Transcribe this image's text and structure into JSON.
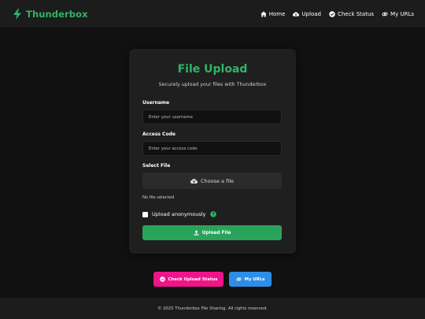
{
  "brand": {
    "name": "Thunderbox",
    "icon": "bolt-icon",
    "color": "#2fb566"
  },
  "nav": {
    "items": [
      {
        "label": "Home",
        "icon": "home-icon"
      },
      {
        "label": "Upload",
        "icon": "cloud-upload-icon"
      },
      {
        "label": "Check Status",
        "icon": "check-circle-icon"
      },
      {
        "label": "My URLs",
        "icon": "link-icon"
      }
    ]
  },
  "form": {
    "title": "File Upload",
    "subtitle": "Securely upload your files with Thunderbox",
    "username_label": "Username",
    "username_placeholder": "Enter your username",
    "username_value": "",
    "access_code_label": "Access Code",
    "access_code_placeholder": "Enter your access code",
    "access_code_value": "",
    "file_label": "Select File",
    "file_button_label": "Choose a file",
    "file_status": "No file selected",
    "anonymous_label": "Upload anonymously",
    "anonymous_checked": false,
    "submit_label": "Upload File"
  },
  "actions": {
    "check_status_label": "Check Upload Status",
    "my_urls_label": "My URLs"
  },
  "colors": {
    "accent_green": "#2aa35a",
    "pink": "#f0148b",
    "blue": "#2e8ee6",
    "background": "#111111",
    "card": "#1f1f1f"
  },
  "footer": {
    "text": "© 2025 Thunderbox File Sharing. All rights reserved."
  }
}
